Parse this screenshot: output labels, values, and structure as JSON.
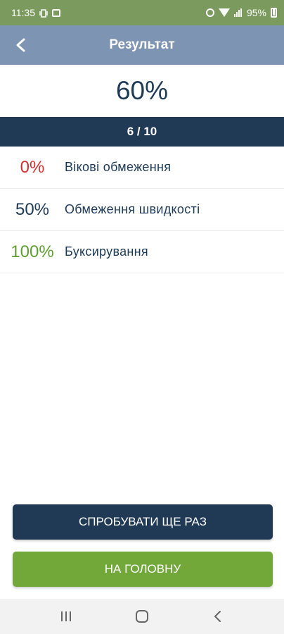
{
  "status_bar": {
    "time": "11:35",
    "battery": "95%",
    "icons": [
      "vibrate-icon",
      "image-icon",
      "alarm-icon",
      "wifi-icon",
      "signal-icon",
      "battery-icon"
    ]
  },
  "app_bar": {
    "title": "Результат",
    "back_icon": "chevron-left-icon"
  },
  "score": "60%",
  "count": "6 / 10",
  "results": [
    {
      "percent": "0%",
      "label": "Вікові обмеження",
      "color": "#d32f2f"
    },
    {
      "percent": "50%",
      "label": "Обмеження швидкості",
      "color": "#1d3b57"
    },
    {
      "percent": "100%",
      "label": "Буксирування",
      "color": "#5f9f2f"
    }
  ],
  "buttons": {
    "retry": "СПРОБУВАТИ ЩЕ РАЗ",
    "home": "НА ГОЛОВНУ"
  },
  "nav_bar": {
    "icons": [
      "recent-apps-icon",
      "home-icon",
      "back-icon"
    ]
  },
  "colors": {
    "status_bar": "#7b9b5e",
    "app_bar": "#7d95b3",
    "dark_navy": "#203a56",
    "green": "#72a83a"
  }
}
